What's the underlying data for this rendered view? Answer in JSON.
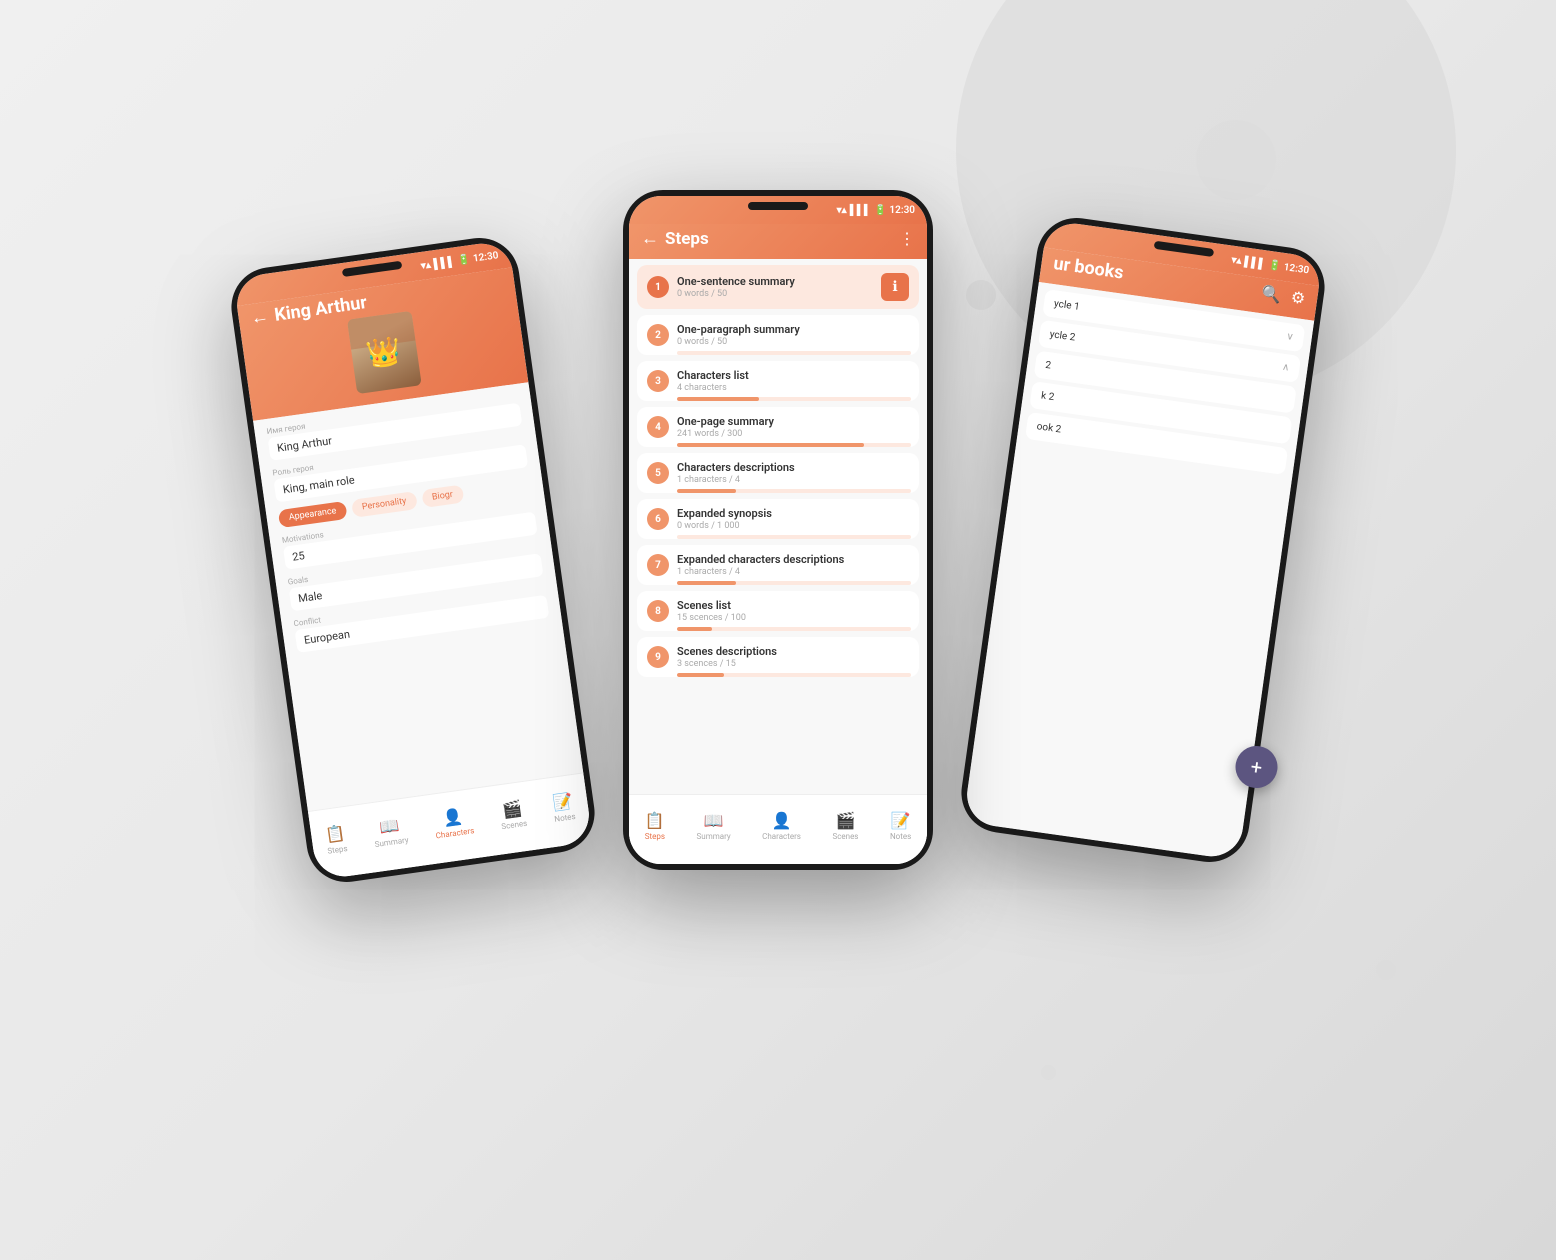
{
  "background": {
    "color": "#ebebeb"
  },
  "phones": {
    "left": {
      "title": "King Arthur",
      "status_time": "12:30",
      "character_name": "King Arthur",
      "character_role": "King, main role",
      "fields": [
        {
          "label": "Имя героя",
          "value": "King Arthur"
        },
        {
          "label": "Роль героя",
          "value": "King, main role"
        },
        {
          "label": "Motivations",
          "value": "25"
        },
        {
          "label": "Goals",
          "value": "Male"
        },
        {
          "label": "Conflict",
          "value": "European"
        }
      ],
      "tabs": [
        "Appearance",
        "Personality",
        "Biogr"
      ],
      "nav_items": [
        "Steps",
        "Summary",
        "Characters",
        "Scenes",
        "Notes"
      ]
    },
    "center": {
      "title": "Steps",
      "status_time": "12:30",
      "steps": [
        {
          "num": "1",
          "name": "One-sentence summary",
          "meta": "0 words / 50",
          "progress": 0,
          "highlighted": true,
          "has_info": true
        },
        {
          "num": "2",
          "name": "One-paragraph summary",
          "meta": "0 words / 50",
          "progress": 0,
          "highlighted": false
        },
        {
          "num": "3",
          "name": "Characters list",
          "meta": "4 characters",
          "progress": 35,
          "highlighted": false
        },
        {
          "num": "4",
          "name": "One-page summary",
          "meta": "241 words / 300",
          "progress": 80,
          "highlighted": false
        },
        {
          "num": "5",
          "name": "Characters descriptions",
          "meta": "1 characters / 4",
          "progress": 25,
          "highlighted": false
        },
        {
          "num": "6",
          "name": "Expanded synopsis",
          "meta": "0 words / 1 000",
          "progress": 0,
          "highlighted": false
        },
        {
          "num": "7",
          "name": "Expanded characters descriptions",
          "meta": "1 characters / 4",
          "progress": 25,
          "highlighted": false
        },
        {
          "num": "8",
          "name": "Scenes list",
          "meta": "15 scences / 100",
          "progress": 15,
          "highlighted": false
        },
        {
          "num": "9",
          "name": "Scenes descriptions",
          "meta": "3 scences / 15",
          "progress": 20,
          "highlighted": false
        }
      ],
      "nav_items": [
        "Steps",
        "Summary",
        "Characters",
        "Scenes",
        "Notes"
      ]
    },
    "right": {
      "title": "ur books",
      "status_time": "12:30",
      "books": [
        {
          "name": "ycle 1"
        },
        {
          "name": "ycle 2"
        },
        {
          "name": "2"
        },
        {
          "name": "k 2"
        },
        {
          "name": "ook 2"
        }
      ],
      "fab_label": "+"
    }
  }
}
